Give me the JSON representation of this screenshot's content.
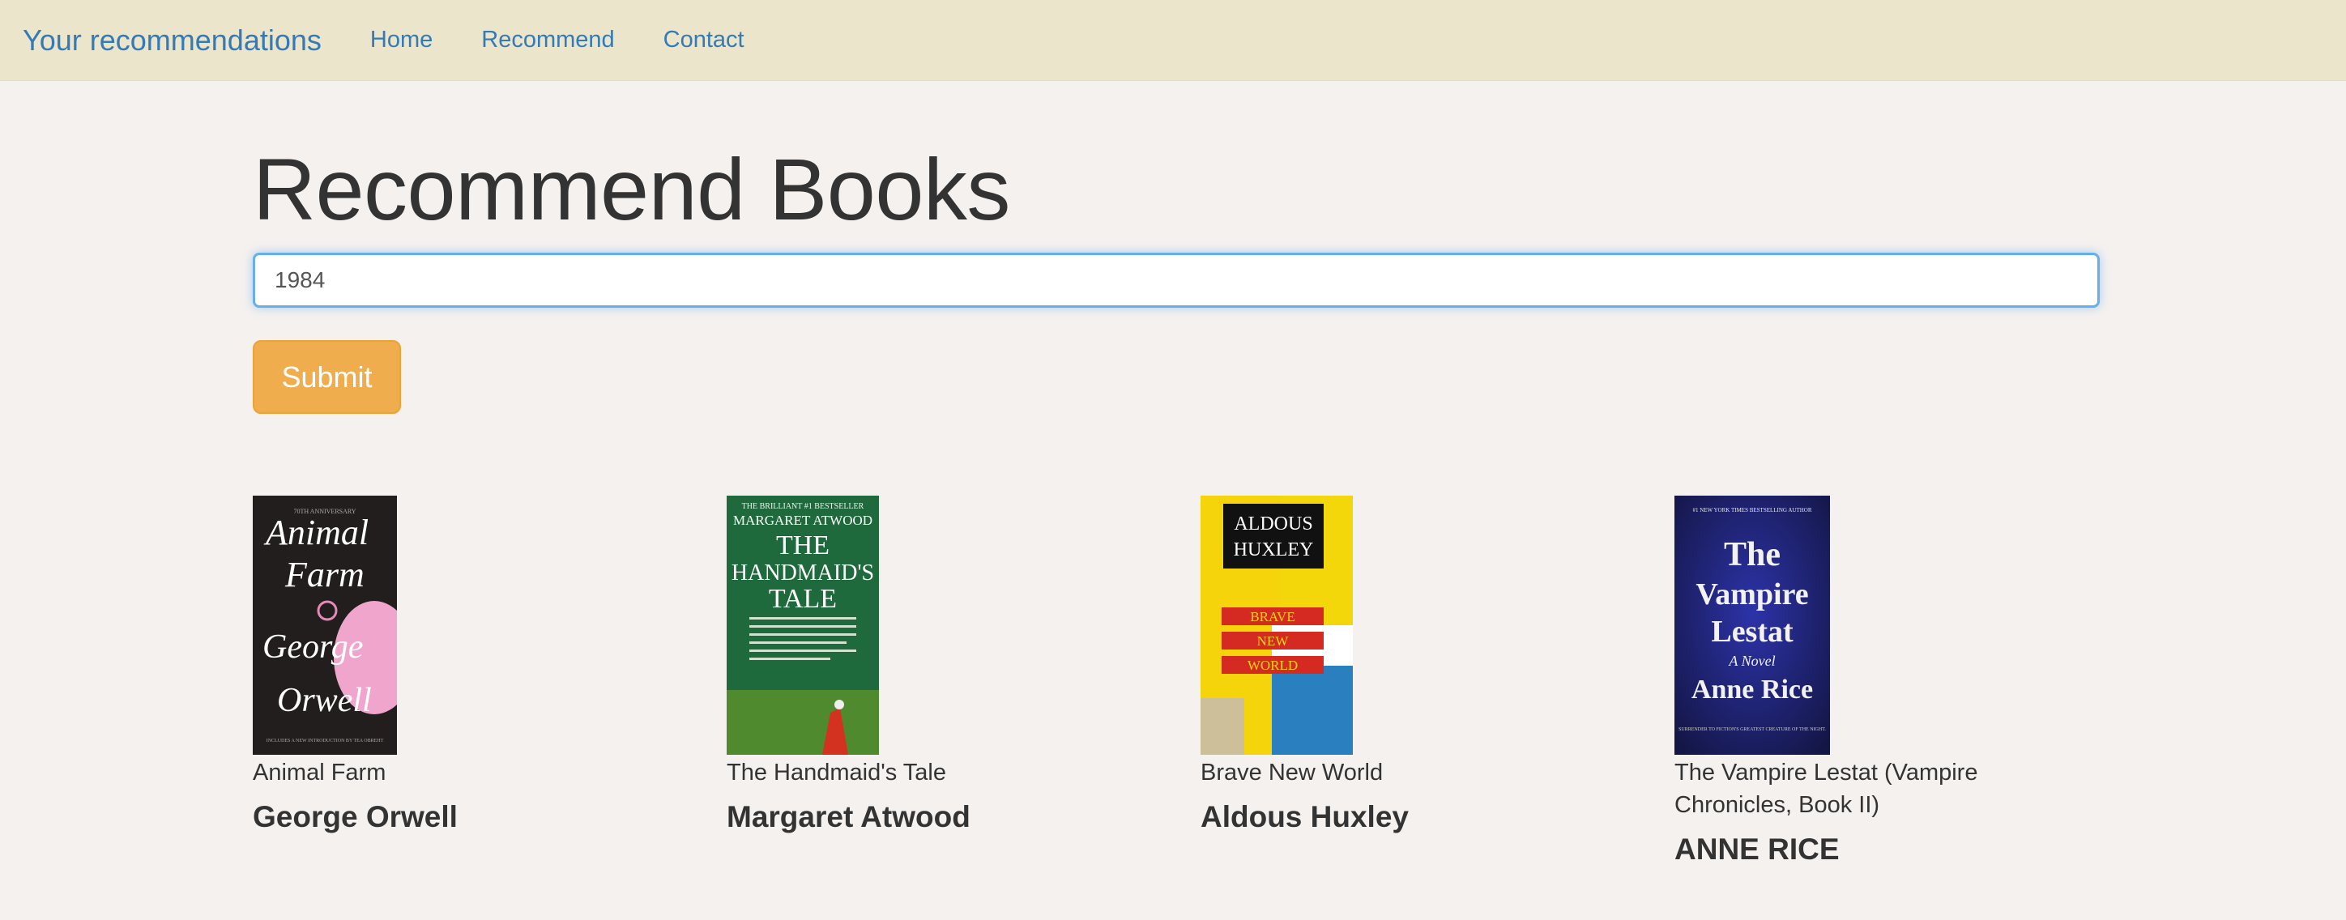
{
  "nav": {
    "brand": "Your recommendations",
    "links": [
      "Home",
      "Recommend",
      "Contact"
    ]
  },
  "main": {
    "heading": "Recommend Books",
    "search": {
      "value": "1984",
      "placeholder": ""
    },
    "submit_label": "Submit"
  },
  "books": [
    {
      "title": "Animal Farm",
      "author": "George Orwell",
      "cover": {
        "top": "70TH ANNIVERSARY",
        "line1": "Animal",
        "line2": "Farm",
        "line3": "George",
        "line4": "Orwell",
        "footer": "INCLUDES A NEW INTRODUCTION BY TEA OBREHT"
      }
    },
    {
      "title": "The Handmaid's Tale",
      "author": "Margaret Atwood",
      "cover": {
        "top": "THE BRILLIANT #1 BESTSELLER",
        "line1": "MARGARET ATWOOD",
        "line2": "THE",
        "line3": "HANDMAID'S",
        "line4": "TALE"
      }
    },
    {
      "title": "Brave New World",
      "author": "Aldous Huxley",
      "cover": {
        "line1": "ALDOUS",
        "line2": "HUXLEY",
        "line3": "BRAVE",
        "line4": "NEW",
        "line5": "WORLD"
      }
    },
    {
      "title": "The Vampire Lestat (Vampire Chronicles, Book II)",
      "author": "ANNE RICE",
      "cover": {
        "top": "#1 NEW YORK TIMES BESTSELLING AUTHOR",
        "line1": "The",
        "line2": "Vampire",
        "line3": "Lestat",
        "line4": "A Novel",
        "line5": "Anne Rice",
        "footer": "SURRENDER TO FICTION'S GREATEST CREATURE OF THE NIGHT."
      }
    }
  ],
  "colors": {
    "navbar_bg": "#ebe5cc",
    "page_bg": "#f5f1ef",
    "link": "#337ab7",
    "submit_bg": "#f0ad4e",
    "focus_border": "#66afe9"
  }
}
